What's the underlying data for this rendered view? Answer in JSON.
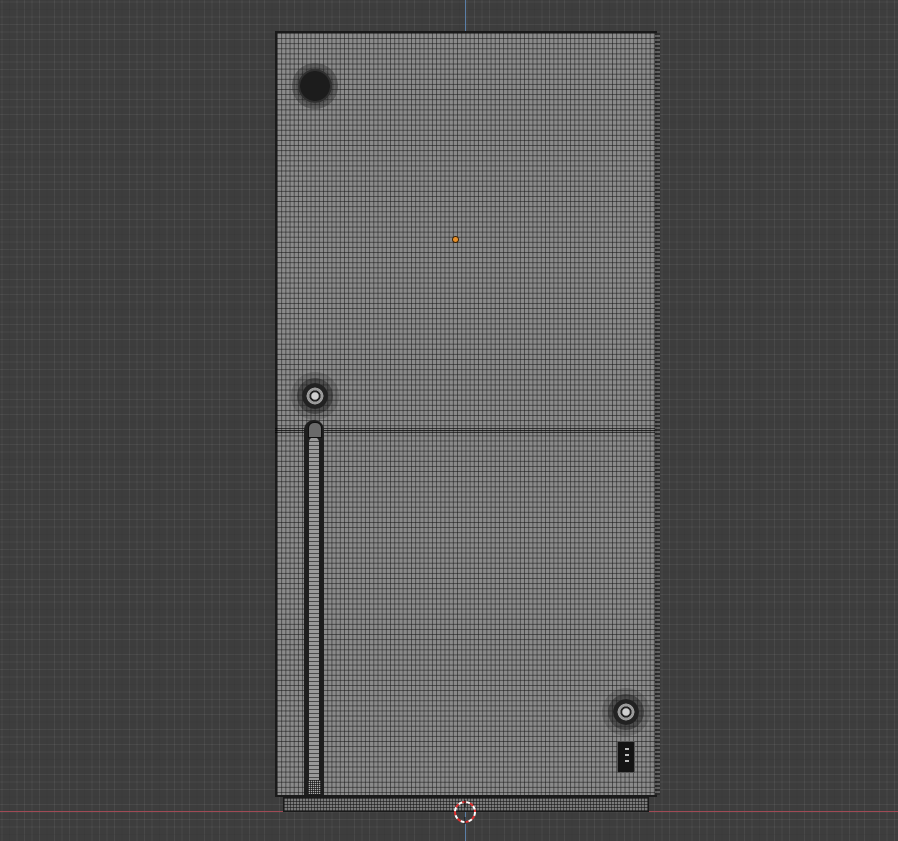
{
  "viewport": {
    "view": "orthographic-front-wireframe",
    "background_color": "#3d3d3d",
    "axis_colors": {
      "x_axis": "#a04a55",
      "z_axis": "#5a7fa8"
    },
    "mesh_color": "#8a8a8a",
    "origin_color": "#e8902a",
    "cursor_colors": [
      "#e03030",
      "#ffffff"
    ]
  },
  "icons": {
    "origin": "object-origin-icon",
    "cursor": "3d-cursor-icon"
  }
}
